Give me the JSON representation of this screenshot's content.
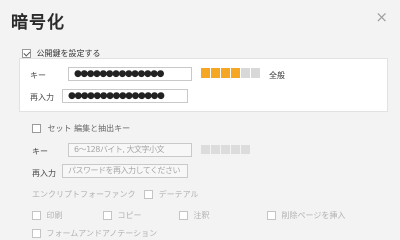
{
  "dialog": {
    "title": "暗号化",
    "close_glyph": "×"
  },
  "public_key_section": {
    "checkbox_label": "公開鍵を設定する",
    "checked": true,
    "key_label": "キー",
    "key_value": "●●●●●●●●●●●●●●",
    "strength_level": 4,
    "strength_max": 6,
    "strength_text": "全般",
    "reenter_label": "再入力",
    "reenter_value": "●●●●●●●●●●●●●●●"
  },
  "cert_section": {
    "checkbox_label": "セット 編集と抽出キー",
    "checked": false,
    "key_label": "キー",
    "key_placeholder": "6～128バイト, 大文字小文",
    "reenter_label": "再入力",
    "reenter_placeholder": "パスワードを再入力してください",
    "encrypt_row_label": "エンクリプトフォーファンク",
    "encrypt_row_value": "デーテアル"
  },
  "permissions": {
    "print": "印刷",
    "copy": "コピー",
    "annotate": "注釈",
    "delete_insert": "削除ページを挿入",
    "form_annotation": "フォームアンドアノテーション"
  },
  "colors": {
    "accent": "#f5a623",
    "strength_empty": "#d8d8d8"
  }
}
